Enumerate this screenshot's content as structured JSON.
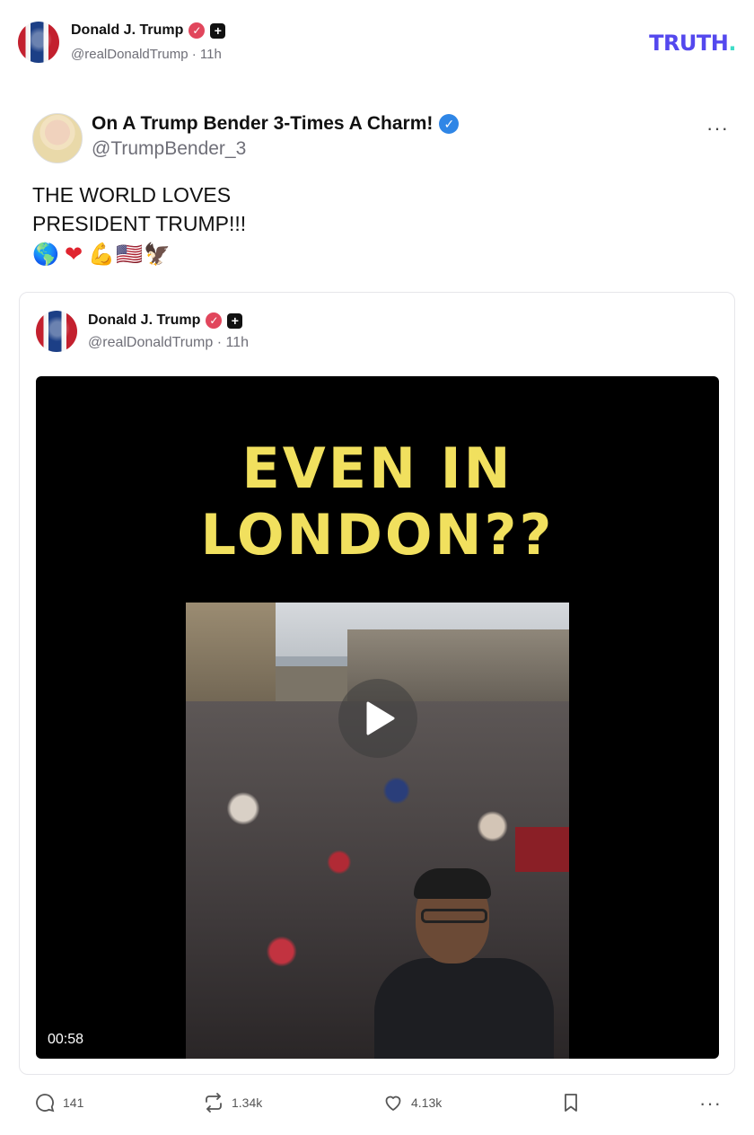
{
  "reposter": {
    "name": "Donald J. Trump",
    "handle_time": "@realDonaldTrump · 11h"
  },
  "brand": {
    "logo_text": "TRUTH",
    "logo_dot": ".",
    "accent": "#5448ee",
    "dot_color": "#3fdcc7"
  },
  "post": {
    "author_name": "On A Trump Bender 3-Times A Charm!",
    "author_handle": "@TrumpBender_3",
    "more_label": "···",
    "text_line1": "THE WORLD LOVES",
    "text_line2": "PRESIDENT TRUMP!!!",
    "emojis": [
      "🌎",
      "❤",
      "💪",
      "🇺🇸",
      "🦅"
    ]
  },
  "quote": {
    "name": "Donald J. Trump",
    "handle_time": "@realDonaldTrump · 11h",
    "video": {
      "caption_line1": "EVEN IN",
      "caption_line2": "LONDON??",
      "duration": "00:58"
    }
  },
  "actions": {
    "replies": "141",
    "retruths": "1.34k",
    "likes": "4.13k",
    "more_label": "···"
  },
  "icons": {
    "verified_red": "verified-badge-icon",
    "plus_badge": "plus-badge-icon",
    "verified_blue": "verified-badge-icon",
    "reply": "reply-icon",
    "retruth": "retruth-icon",
    "like": "heart-icon",
    "bookmark": "bookmark-icon",
    "play": "play-icon"
  }
}
